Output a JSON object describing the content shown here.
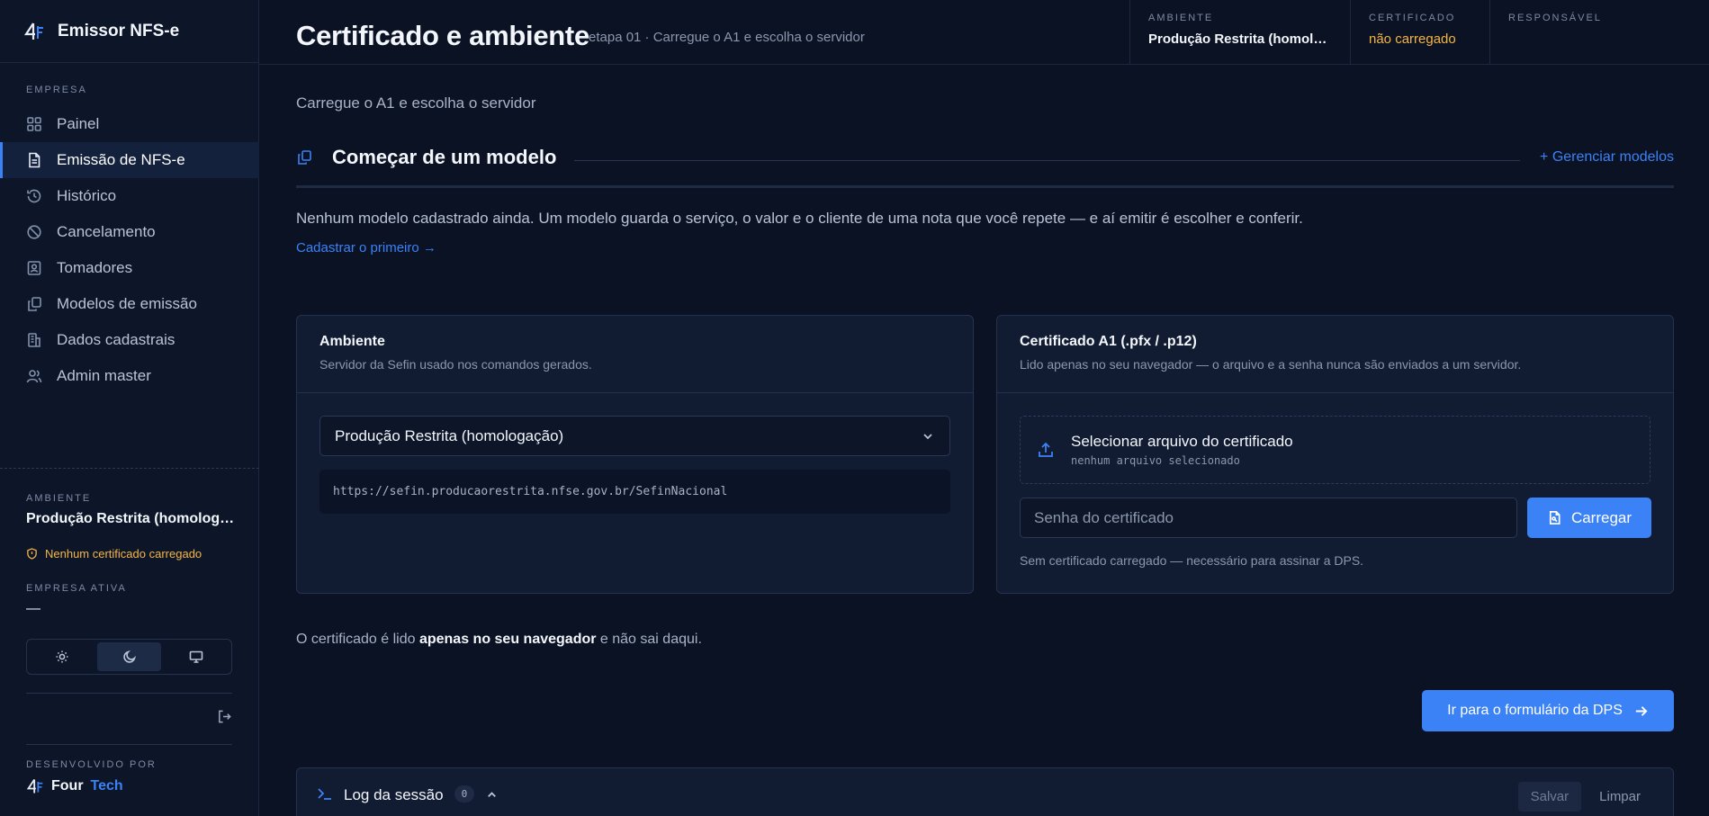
{
  "app": {
    "name": "Emissor NFS-e"
  },
  "sidebar": {
    "section_label": "EMPRESA",
    "items": [
      {
        "label": "Painel",
        "icon": "grid-icon"
      },
      {
        "label": "Emissão de NFS-e",
        "icon": "document-icon",
        "active": true
      },
      {
        "label": "Histórico",
        "icon": "history-icon"
      },
      {
        "label": "Cancelamento",
        "icon": "ban-icon"
      },
      {
        "label": "Tomadores",
        "icon": "contact-icon"
      },
      {
        "label": "Modelos de emissão",
        "icon": "copy-icon"
      },
      {
        "label": "Dados cadastrais",
        "icon": "building-icon"
      },
      {
        "label": "Admin master",
        "icon": "users-icon"
      }
    ],
    "env_label": "AMBIENTE",
    "env_value": "Produção Restrita (homologação)",
    "cert_warning": "Nenhum certificado carregado",
    "company_label": "EMPRESA ATIVA",
    "company_value": "—",
    "theme_active": "dark",
    "dev_label": "DESENVOLVIDO POR",
    "dev_brand_a": "Four",
    "dev_brand_b": "Tech"
  },
  "header": {
    "title": "Certificado e ambiente",
    "subtitle": "etapa 01 · Carregue o A1 e escolha o servidor",
    "env_label": "AMBIENTE",
    "env_value": "Produção Restrita (homologação)",
    "cert_label": "CERTIFICADO",
    "cert_value": "não carregado",
    "resp_label": "RESPONSÁVEL",
    "resp_value": ""
  },
  "main": {
    "intro": "Carregue o A1 e escolha o servidor",
    "models": {
      "title": "Começar de um modelo",
      "manage_link": "+ Gerenciar modelos",
      "empty_text": "Nenhum modelo cadastrado ainda. Um modelo guarda o serviço, o valor e o cliente de uma nota que você repete — e aí emitir é escolher e conferir.",
      "first_link": "Cadastrar o primeiro →"
    },
    "env_card": {
      "title": "Ambiente",
      "desc": "Servidor da Sefin usado nos comandos gerados.",
      "select_value": "Produção Restrita (homologação)",
      "url": "https://sefin.producaorestrita.nfse.gov.br/SefinNacional"
    },
    "cert_card": {
      "title": "Certificado A1 (.pfx / .p12)",
      "desc": "Lido apenas no seu navegador — o arquivo e a senha nunca são enviados a um servidor.",
      "file_title": "Selecionar arquivo do certificado",
      "file_sub": "nenhum arquivo selecionado",
      "password_placeholder": "Senha do certificado",
      "load_button": "Carregar",
      "note": "Sem certificado carregado — necessário para assinar a DPS."
    },
    "browser_note_a": "O certificado é lido ",
    "browser_note_b": "apenas no seu navegador",
    "browser_note_c": " e não sai daqui.",
    "go_button": "Ir para o formulário da DPS",
    "log": {
      "title": "Log da sessão",
      "count": "0",
      "save": "Salvar",
      "clear": "Limpar"
    }
  },
  "colors": {
    "accent": "#3b82f6",
    "warning": "#f5b544",
    "background": "#0b1224"
  }
}
